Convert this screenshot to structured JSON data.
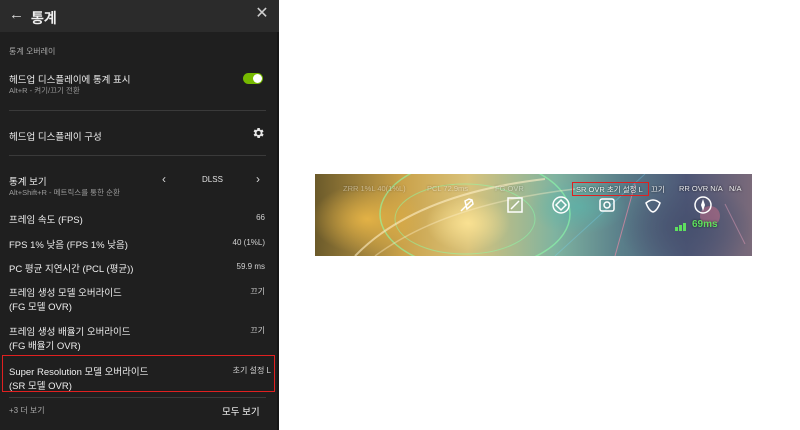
{
  "panel": {
    "back_icon": "←",
    "title": "통계",
    "close_icon": "✕",
    "section_label": "통계 오버레이",
    "hud_toggle": {
      "title": "헤드업 디스플레이에 통계 표시",
      "sub": "Alt+R - 켜기/끄기 전환",
      "on": true
    },
    "hud_config": {
      "title": "헤드업 디스플레이 구성"
    },
    "stats_view": {
      "title": "통계 보기",
      "sub": "Alt+Shift+R - 메트릭스를 통한 순환",
      "value": "DLSS",
      "prev": "‹",
      "next": "›"
    },
    "rows": [
      {
        "title": "프레임 속도 (FPS)",
        "value": "66"
      },
      {
        "title": "FPS 1% 낮음 (FPS 1% 낮음)",
        "value": "40 (1%L)"
      },
      {
        "title": "PC 평균 지연시간 (PCL (평균))",
        "value": "59.9 ms"
      },
      {
        "title": "프레임 생성 모델 오버라이드",
        "title2": "(FG 모델 OVR)",
        "value": "끄기"
      },
      {
        "title": "프레임 생성 배율기 오버라이드",
        "title2": "(FG 배율기 OVR)",
        "value": "끄기"
      },
      {
        "title": "Super Resolution 모델 오버라이드",
        "title2": "(SR 모델 OVR)",
        "value": "초기 설정 L"
      }
    ],
    "more_link": "+3 더 보기",
    "all_link": "모두 보기"
  },
  "game": {
    "hud": {
      "item1": "ZRR 1%L 40(1%L)",
      "item2": "PCL 72.9ms",
      "item3": "FG OVR",
      "sr": "SR OVR 초기 설정 L",
      "item5": "끄기",
      "rr": "RR OVR N/A",
      "rr_value": "N/A"
    },
    "ping": "69ms",
    "colors": {
      "ping": "#5ee05e",
      "highlight": "#e02020",
      "toggle": "#76b900"
    }
  }
}
